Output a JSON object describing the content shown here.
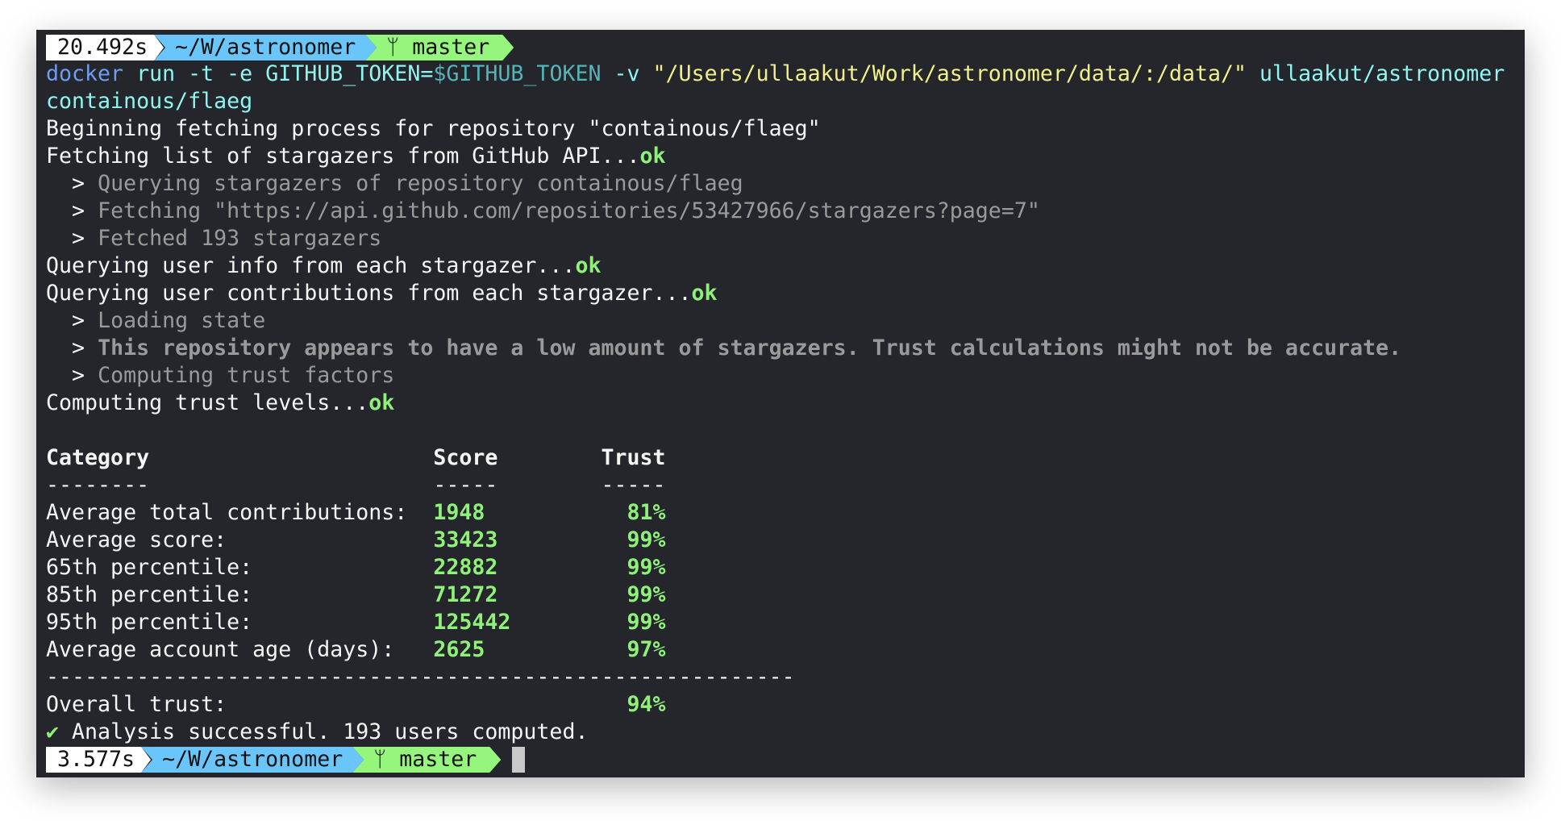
{
  "prompt1": {
    "time": "20.492s",
    "dir": "~/W/astronomer",
    "branch_icon": "git-branch-icon",
    "branch": "master"
  },
  "command": {
    "cmd": "docker",
    "args1": " run -t -e GITHUB_TOKEN=",
    "var": "$GITHUB_TOKEN",
    "args2": " -v ",
    "path": "\"/Users/ullaakut/Work/astronomer/data/:/data/\"",
    "args3": " ullaakut/astronomer",
    "line2": "containous/flaeg"
  },
  "log": [
    {
      "text": "Beginning fetching process for repository \"containous/flaeg\"",
      "ok": ""
    },
    {
      "text": "Fetching list of stargazers from GitHub API...",
      "ok": "ok"
    },
    {
      "sub": "Querying stargazers of repository containous/flaeg"
    },
    {
      "sub": "Fetching \"https://api.github.com/repositories/53427966/stargazers?page=7\""
    },
    {
      "sub": "Fetched 193 stargazers"
    },
    {
      "text": "Querying user info from each stargazer...",
      "ok": "ok"
    },
    {
      "text": "Querying user contributions from each stargazer...",
      "ok": "ok"
    },
    {
      "sub": "Loading state"
    },
    {
      "sub": "This repository appears to have a low amount of stargazers. Trust calculations might not be accurate.",
      "bold": true
    },
    {
      "sub": "Computing trust factors"
    },
    {
      "text": "Computing trust levels...",
      "ok": "ok"
    }
  ],
  "sub_marker": ">",
  "table": {
    "headers": [
      "Category",
      "Score",
      "Trust"
    ],
    "underlines": [
      "--------",
      "-----",
      "-----"
    ],
    "rows": [
      {
        "category": "Average total contributions:",
        "score": "1948",
        "trust": "81%"
      },
      {
        "category": "Average score:",
        "score": "33423",
        "trust": "99%"
      },
      {
        "category": "65th percentile:",
        "score": "22882",
        "trust": "99%"
      },
      {
        "category": "85th percentile:",
        "score": "71272",
        "trust": "99%"
      },
      {
        "category": "95th percentile:",
        "score": "125442",
        "trust": "99%"
      },
      {
        "category": "Average account age (days):",
        "score": "2625",
        "trust": "97%"
      }
    ],
    "separator": "----------------------------------------------------------",
    "overall_label": "Overall trust:",
    "overall_value": "94%"
  },
  "result": {
    "check": "✔",
    "text": "Analysis successful. 193 users computed."
  },
  "prompt2": {
    "time": "3.577s",
    "dir": "~/W/astronomer",
    "branch": "master"
  }
}
